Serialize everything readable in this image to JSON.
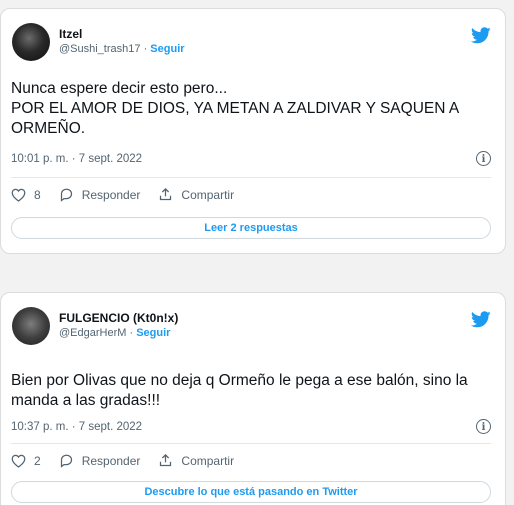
{
  "tweets": [
    {
      "name": "Itzel",
      "handle": "@Sushi_trash17",
      "separator": "·",
      "follow": "Seguir",
      "text": "Nunca espere decir esto pero...\nPOR EL AMOR DE DIOS, YA METAN A ZALDIVAR Y SAQUEN A ORMEÑO.",
      "timestamp": "10:01 p. m. · 7 sept. 2022",
      "likes": "8",
      "reply": "Responder",
      "share": "Compartir",
      "bottom_button": "Leer 2 respuestas"
    },
    {
      "name": "FULGENCIO (Kt0n!x)",
      "handle": "@EdgarHerM",
      "separator": "·",
      "follow": "Seguir",
      "text": "Bien por Olivas que no deja q Ormeño le pega a ese balón, sino la manda a las gradas!!!",
      "timestamp": "10:37 p. m. · 7 sept. 2022",
      "likes": "2",
      "reply": "Responder",
      "share": "Compartir",
      "bottom_button": "Descubre lo que está pasando en Twitter"
    }
  ],
  "info_glyph": "i",
  "colors": {
    "accent": "#1d9bf0",
    "muted": "#536471",
    "page_bg": "#f2f2f2"
  },
  "icons": [
    "twitter-bird-icon",
    "heart-icon",
    "reply-bubble-icon",
    "share-icon",
    "info-icon"
  ]
}
